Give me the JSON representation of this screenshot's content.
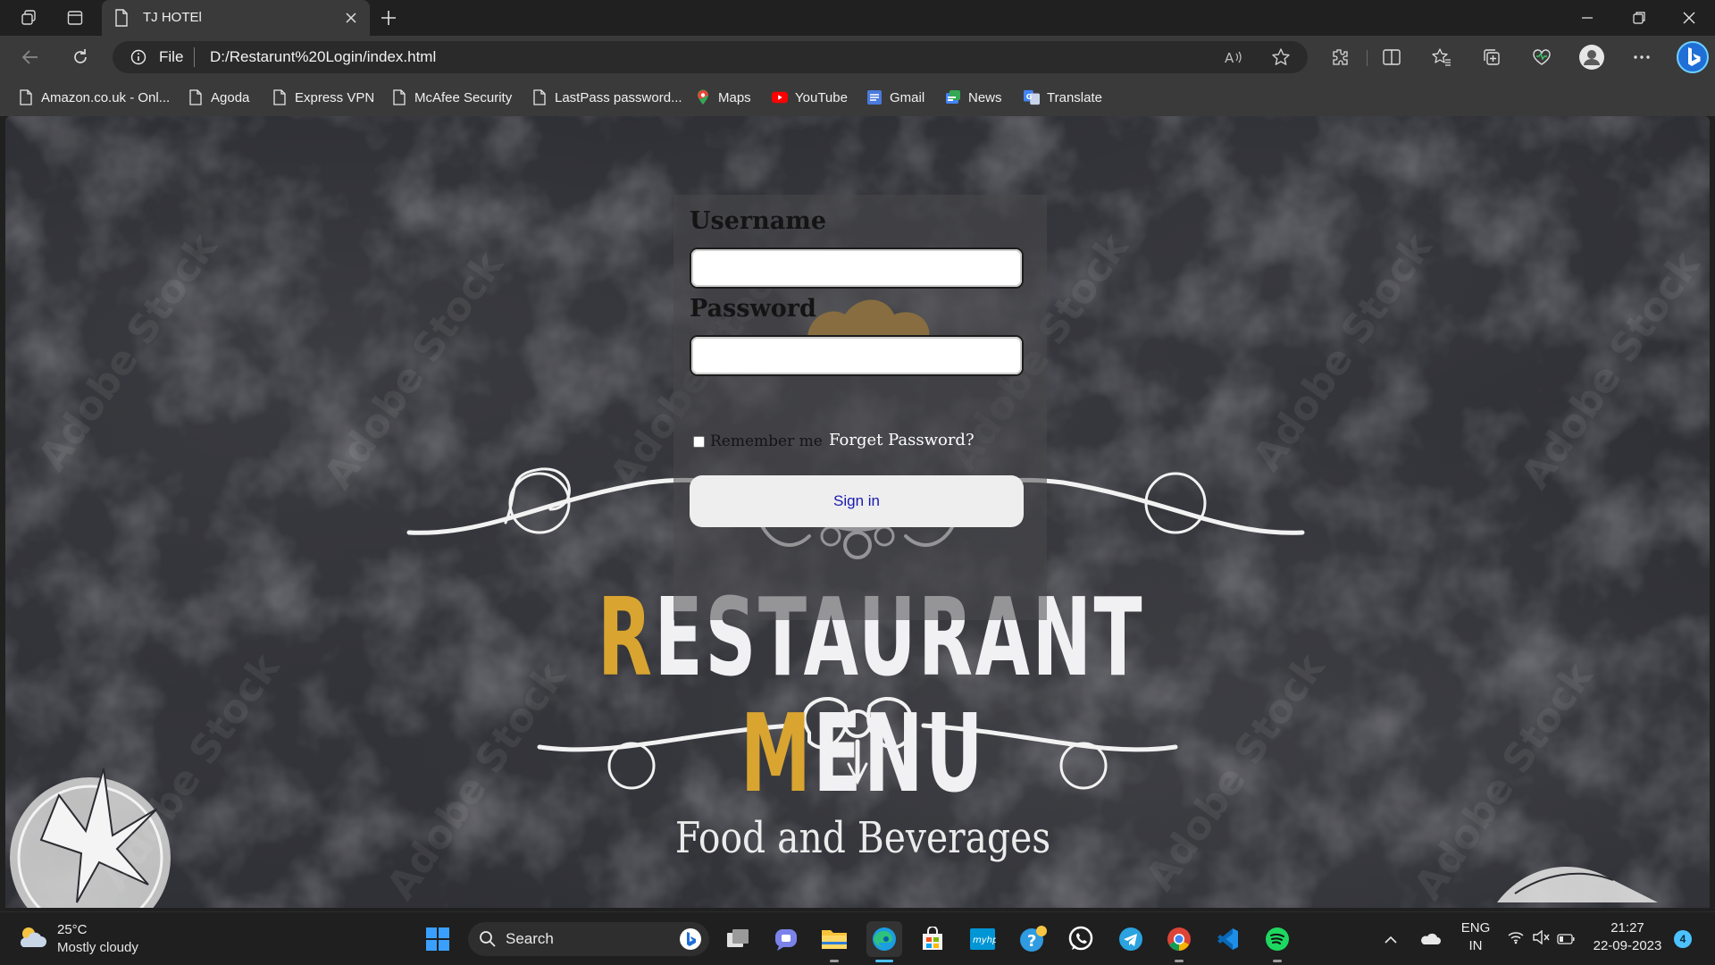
{
  "browser": {
    "tab_title": "TJ HOTEl",
    "scheme_label": "File",
    "url": "D:/Restarunt%20Login/index.html"
  },
  "favorites": [
    {
      "label": "Amazon.co.uk - Onl...",
      "icon": "page-icon"
    },
    {
      "label": "Agoda",
      "icon": "page-icon"
    },
    {
      "label": "Express VPN",
      "icon": "page-icon"
    },
    {
      "label": "McAfee Security",
      "icon": "page-icon"
    },
    {
      "label": "LastPass password...",
      "icon": "page-icon"
    },
    {
      "label": "Maps",
      "icon": "maps-icon"
    },
    {
      "label": "YouTube",
      "icon": "youtube-icon"
    },
    {
      "label": "Gmail",
      "icon": "gmail-icon"
    },
    {
      "label": "News",
      "icon": "news-icon"
    },
    {
      "label": "Translate",
      "icon": "translate-icon"
    }
  ],
  "login": {
    "username_label": "Username",
    "username_value": "",
    "password_label": "Password",
    "password_value": "",
    "remember_label": "Remember me",
    "remember_checked": false,
    "forget_label": "Forget Password?",
    "signin_label": "Sign in"
  },
  "background": {
    "title_part1": "R",
    "title_part2": "ESTAURANT ",
    "title_part3": "M",
    "title_part4": "ENU",
    "subtitle": "Food and Beverages",
    "accent_color": "#d9a530"
  },
  "taskbar": {
    "weather_temp": "25°C",
    "weather_desc": "Mostly cloudy",
    "search_label": "Search",
    "lang_line1": "ENG",
    "lang_line2": "IN",
    "time": "21:27",
    "date": "22-09-2023",
    "notification_count": "4"
  }
}
